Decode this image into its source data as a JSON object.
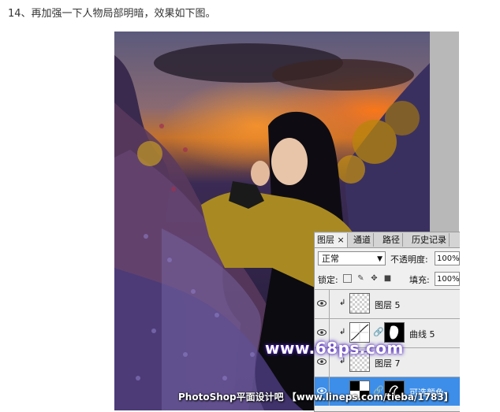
{
  "heading": "14、再加强一下人物局部明暗，效果如下图。",
  "panel": {
    "tabs": [
      {
        "label": "图层 ×",
        "active": true
      },
      {
        "label": "通道",
        "active": false
      },
      {
        "label": "路径",
        "active": false
      },
      {
        "label": "历史记录",
        "active": false
      }
    ],
    "blend_mode": "正常",
    "opacity_label": "不透明度:",
    "opacity_value": "100%",
    "lock_label": "锁定:",
    "fill_label": "填充:",
    "fill_value": "100%",
    "layers": [
      {
        "name": "图层 5",
        "visible": true,
        "clipped": true,
        "type": "pixel",
        "selected": false
      },
      {
        "name": "曲线 5",
        "visible": true,
        "clipped": true,
        "type": "curves",
        "selected": false
      },
      {
        "name": "图层 7",
        "visible": true,
        "clipped": true,
        "type": "pixel",
        "selected": false
      },
      {
        "name": "可选颜色",
        "visible": true,
        "clipped": false,
        "type": "adjustment",
        "selected": true
      }
    ]
  },
  "watermarks": {
    "site": "www.68ps.com",
    "credit": "PhotoShop平面设计吧 【www.lineps.com/tieba/1783】"
  },
  "colors": {
    "selected_layer": "#3d8ee8",
    "panel_bg": "#f0f0f0"
  }
}
